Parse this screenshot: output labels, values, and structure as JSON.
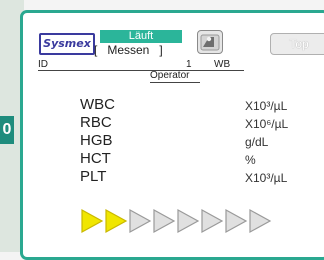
{
  "left_edge": {
    "glyph": "0"
  },
  "header": {
    "brand": "Sysmex",
    "status": "Läuft",
    "mode": "[   Messen   ]",
    "top_button": "Top"
  },
  "sample": {
    "id_label": "ID",
    "rack_value": "1",
    "mode_value": "WB",
    "operator_label": "Operator"
  },
  "params": [
    {
      "name": "WBC",
      "unit": "X10³/µL"
    },
    {
      "name": "RBC",
      "unit": "X10⁶/µL"
    },
    {
      "name": "HGB",
      "unit": "g/dL"
    },
    {
      "name": "HCT",
      "unit": "%"
    },
    {
      "name": "PLT",
      "unit": "X10³/µL"
    }
  ],
  "progress": {
    "filled_steps": 2,
    "total_steps": 8,
    "filled_color": "#f0e600",
    "empty_color": "#e0e0e0"
  },
  "colors": {
    "frame_accent": "#2aa890",
    "status_badge": "#2bb59a",
    "brand": "#3a3a9e"
  }
}
